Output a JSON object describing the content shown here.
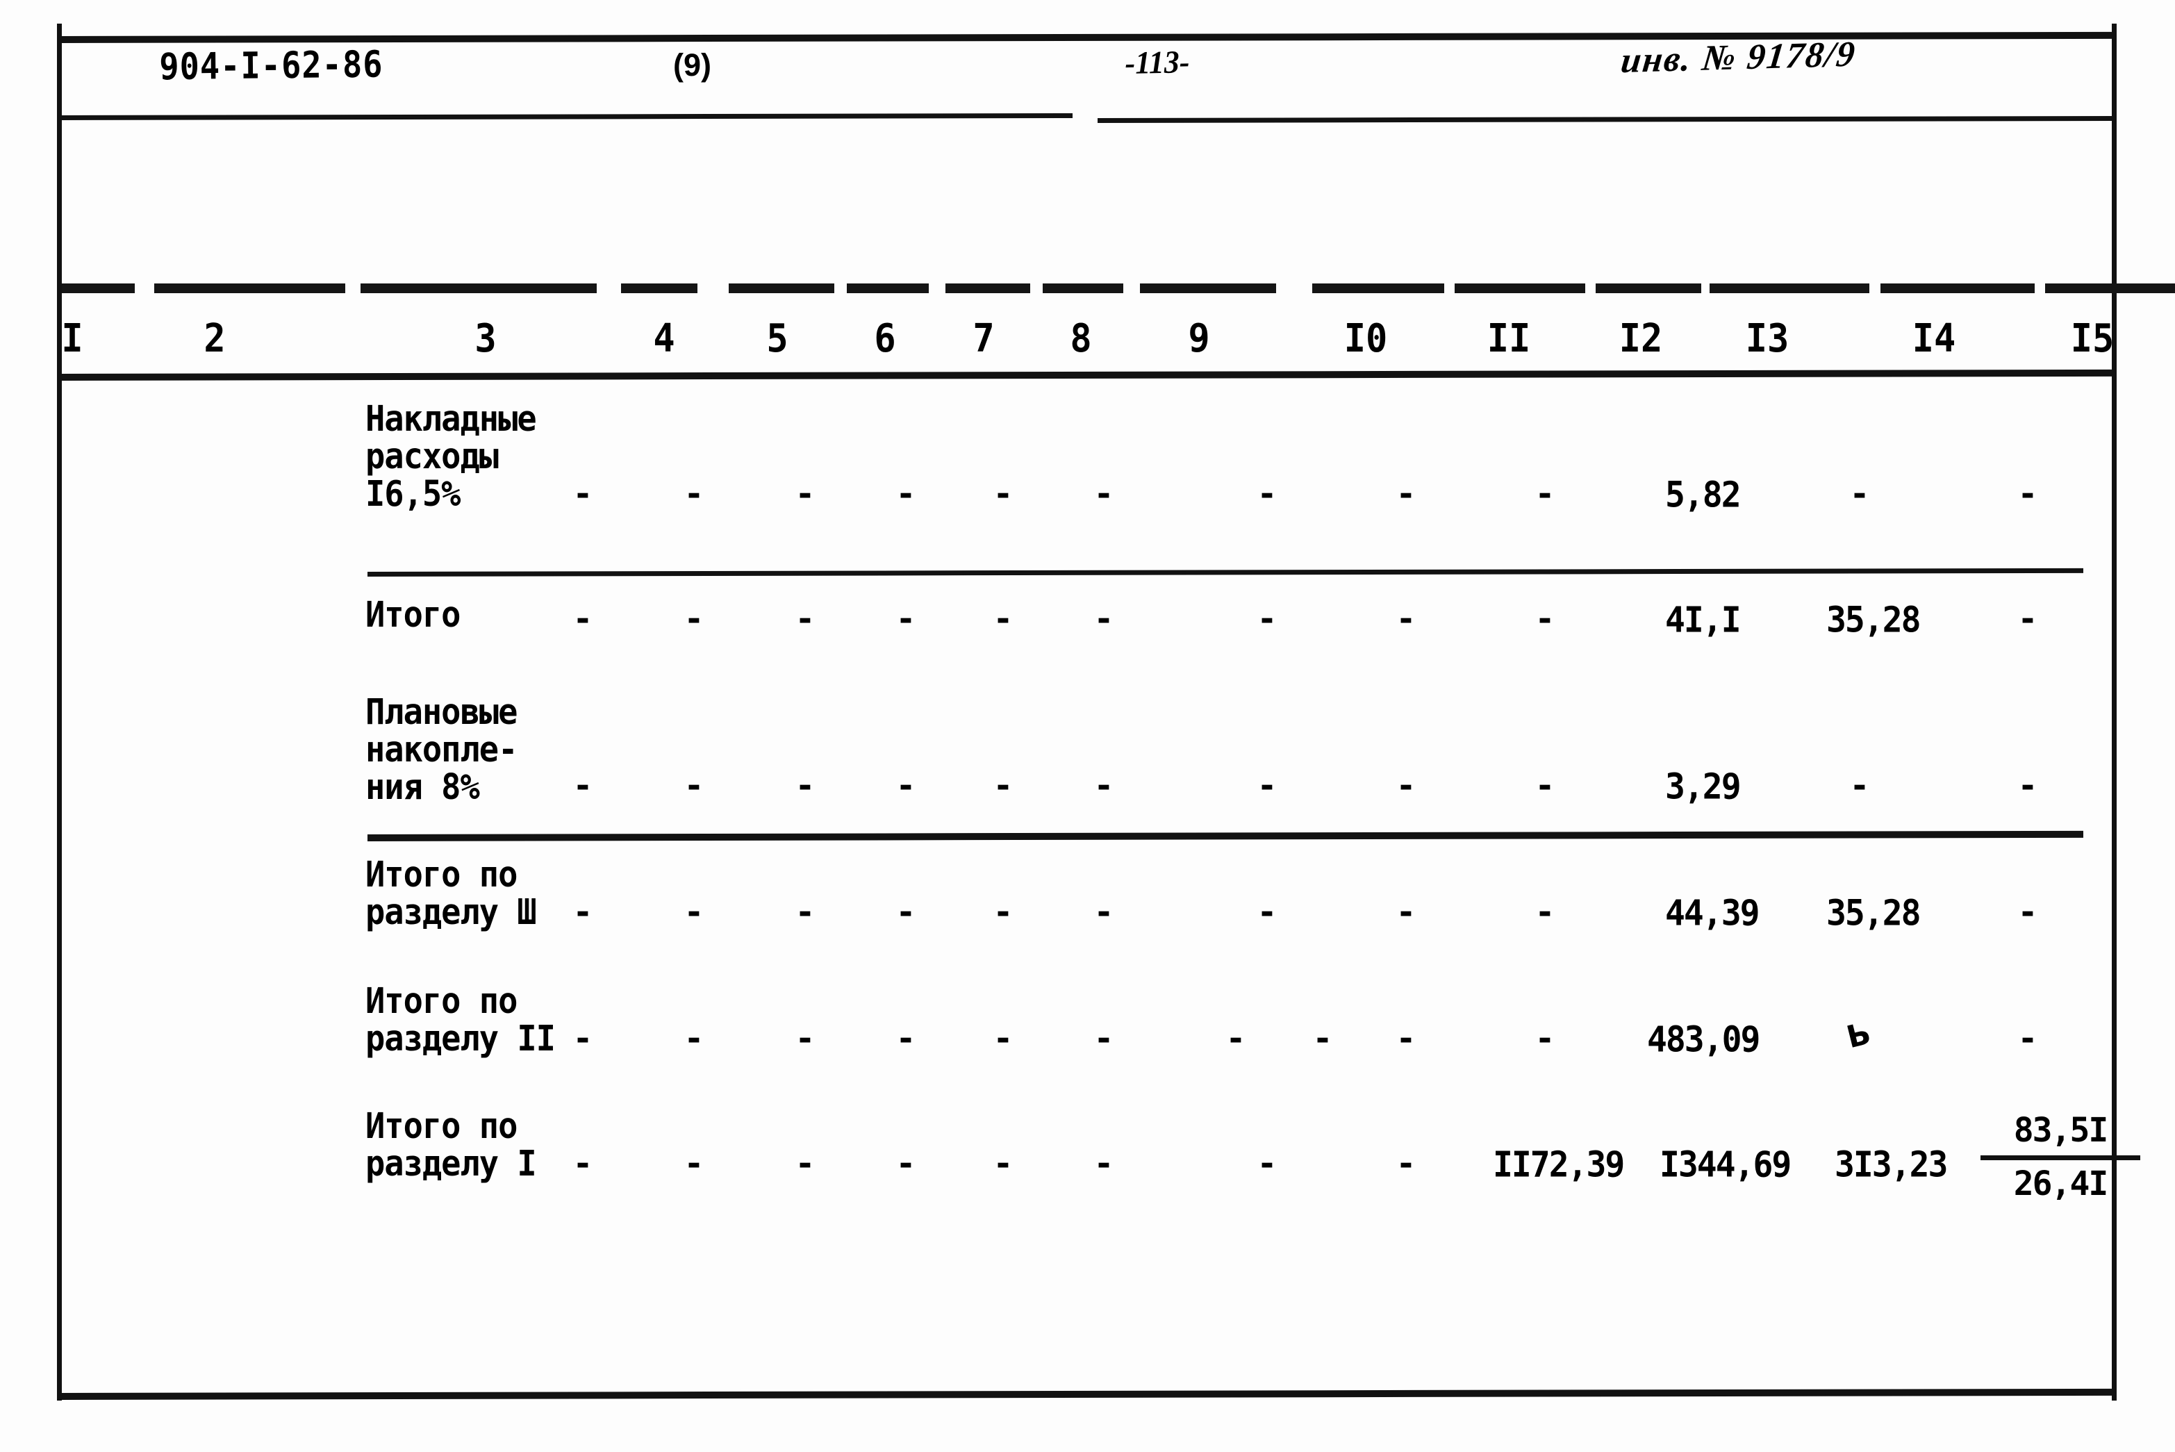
{
  "document": {
    "series_code": "904-I-62-86",
    "sheet_number": "(9)",
    "page_number": "-113-",
    "inventory_label": "инв. № 9178/9"
  },
  "table": {
    "column_numbers": [
      "I",
      "2",
      "3",
      "4",
      "5",
      "6",
      "7",
      "8",
      "9",
      "I0",
      "II",
      "I2",
      "I3",
      "I4",
      "I5"
    ],
    "dash_glyph": "-",
    "rows": [
      {
        "name": "overhead-costs",
        "label": "Накладные\nрасходы\nI6,5%",
        "values": {
          "c4": "-",
          "c5": "-",
          "c6": "-",
          "c7": "-",
          "c8": "-",
          "c9": "-",
          "c10": "-",
          "c11": "-",
          "c12": "-",
          "c13": "5,82",
          "c14": "-",
          "c15": "-"
        }
      },
      {
        "name": "subtotal",
        "label": "Итого",
        "values": {
          "c4": "-",
          "c5": "-",
          "c6": "-",
          "c7": "-",
          "c8": "-",
          "c9": "-",
          "c10": "-",
          "c11": "-",
          "c12": "-",
          "c13": "4I,I",
          "c14": "35,28",
          "c15": "-"
        }
      },
      {
        "name": "planned-savings",
        "label": "Плановые\nнакопле-\nния 8%",
        "values": {
          "c4": "-",
          "c5": "-",
          "c6": "-",
          "c7": "-",
          "c8": "-",
          "c9": "-",
          "c10": "-",
          "c11": "-",
          "c12": "-",
          "c13": "3,29",
          "c14": "-",
          "c15": "-"
        }
      },
      {
        "name": "total-section-3",
        "label": "Итого по\nразделу Ш",
        "values": {
          "c4": "-",
          "c5": "-",
          "c6": "-",
          "c7": "-",
          "c8": "-",
          "c9": "-",
          "c10": "-",
          "c11": "-",
          "c12": "-",
          "c13": "44,39",
          "c14": "35,28",
          "c15": "-"
        }
      },
      {
        "name": "total-section-2",
        "label": "Итого по\nразделу II",
        "values": {
          "c4": "-",
          "c5": "-",
          "c6": "-",
          "c7": "-",
          "c8": "-",
          "c9": "-",
          "c10": "-",
          "c10b": "-",
          "c11": "-",
          "c12": "-",
          "c13": "483,09",
          "c14": "Ь",
          "c15": "-"
        }
      },
      {
        "name": "total-section-1",
        "label": "Итого по\nразделу I",
        "values": {
          "c4": "-",
          "c5": "-",
          "c6": "-",
          "c7": "-",
          "c8": "-",
          "c9": "-",
          "c10": "-",
          "c11": "-",
          "c12": "II72,39",
          "c13": "I344,69",
          "c14": "3I3,23",
          "c15_numerator": "83,5I",
          "c15_denominator": "26,4I"
        }
      }
    ]
  }
}
